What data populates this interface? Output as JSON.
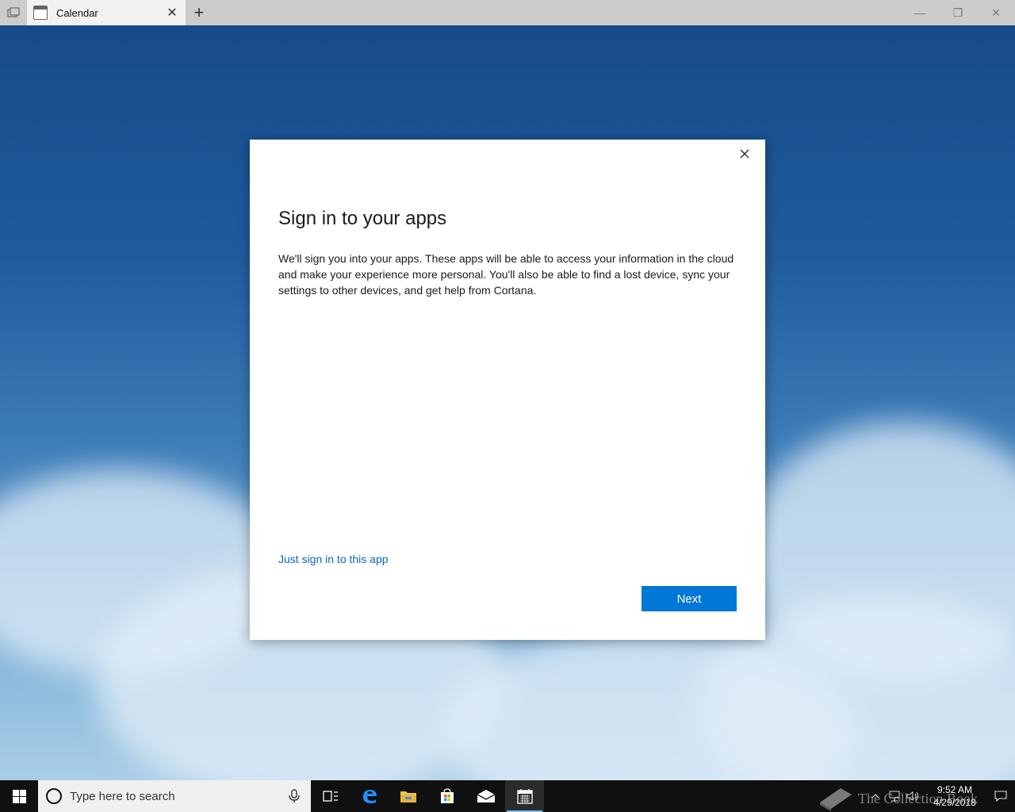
{
  "titlebar": {
    "tab_title": "Calendar",
    "tab_close_glyph": "✕",
    "new_tab_glyph": "+",
    "minimize_glyph": "—",
    "restore_glyph": "❐",
    "close_glyph": "✕"
  },
  "dialog": {
    "title": "Sign in to your apps",
    "body": "We'll sign you into your apps. These apps will be able to access your information in the cloud and make your experience more personal. You'll also be able to find a lost device, sync your settings to other devices, and get help from Cortana.",
    "link": "Just sign in to this app",
    "next_label": "Next"
  },
  "taskbar": {
    "search_placeholder": "Type here to search",
    "pinned": [
      "task-view-icon",
      "edge-icon",
      "file-explorer-icon",
      "store-icon",
      "mail-icon",
      "calendar-icon"
    ],
    "active_app": "calendar-icon",
    "accent": "#0078d7"
  },
  "tray": {
    "time": "9:52 AM",
    "date": "4/29/2018",
    "watermark": "The Collection Book"
  }
}
